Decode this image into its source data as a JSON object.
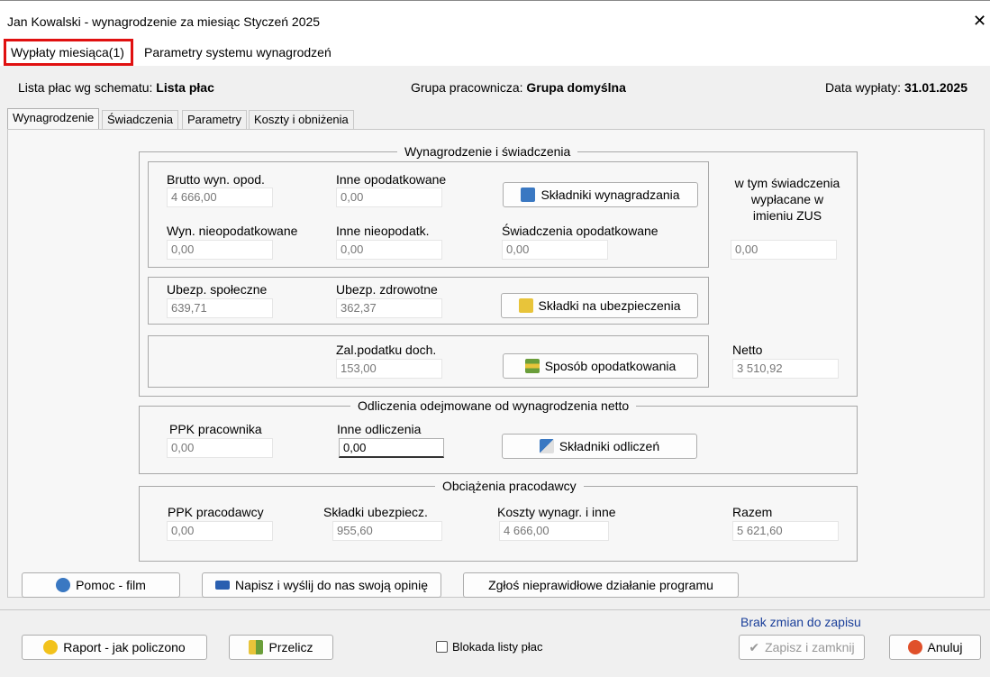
{
  "window": {
    "title": "Jan Kowalski - wynagrodzenie za miesiąc Styczeń 2025",
    "close": "✕"
  },
  "top_tabs": [
    "Wypłaty miesiąca(1)",
    "Parametry systemu wynagrodzeń"
  ],
  "header": {
    "schema_label": "Lista płac wg schematu:",
    "schema_value": "Lista płac",
    "group_label": "Grupa pracownicza:",
    "group_value": "Grupa domyślna",
    "date_label": "Data wypłaty:",
    "date_value": "31.01.2025"
  },
  "sub_tabs": [
    "Wynagrodzenie",
    "Świadczenia",
    "Parametry",
    "Koszty i obniżenia"
  ],
  "sec_wyn": {
    "title": "Wynagrodzenie i świadczenia",
    "brutto_label": "Brutto wyn. opod.",
    "brutto": "4 666,00",
    "inne_opod_label": "Inne opodatkowane",
    "inne_opod": "0,00",
    "wyn_nieopod_label": "Wyn. nieopodatkowane",
    "wyn_nieopod": "0,00",
    "inne_nieopod_label": "Inne nieopodatk.",
    "inne_nieopod": "0,00",
    "swiad_opod_label": "Świadczenia opodatkowane",
    "swiad_opod": "0,00",
    "zus_label": "w tym świadczenia wypłacane w imieniu ZUS",
    "zus": "0,00",
    "btn_skladniki": "Składniki wynagradzania",
    "ubezp_spol_label": "Ubezp. społeczne",
    "ubezp_spol": "639,71",
    "ubezp_zdr_label": "Ubezp. zdrowotne",
    "ubezp_zdr": "362,37",
    "btn_skladki": "Składki na ubezpieczenia",
    "zal_label": "Zal.podatku doch.",
    "zal": "153,00",
    "btn_sposob": "Sposób opodatkowania",
    "netto_label": "Netto",
    "netto": "3 510,92"
  },
  "sec_odl": {
    "title": "Odliczenia odejmowane od wynagrodzenia netto",
    "ppk_prac_label": "PPK pracownika",
    "ppk_prac": "0,00",
    "inne_odl_label": "Inne odliczenia",
    "inne_odl": "0,00",
    "btn_odl": "Składniki odliczeń"
  },
  "sec_obc": {
    "title": "Obciążenia pracodawcy",
    "ppk_pracod_label": "PPK pracodawcy",
    "ppk_pracod": "0,00",
    "skl_ubezp_label": "Składki ubezpiecz.",
    "skl_ubezp": "955,60",
    "koszty_label": "Koszty wynagr. i inne",
    "koszty": "4 666,00",
    "razem_label": "Razem",
    "razem": "5 621,60"
  },
  "help": {
    "film": "Pomoc - film",
    "opinia": "Napisz i wyślij do nas swoją opinię",
    "zglos": "Zgłoś nieprawidłowe działanie programu"
  },
  "footer": {
    "status": "Brak zmian do zapisu",
    "raport": "Raport - jak policzono",
    "przelicz": "Przelicz",
    "blokada": "Blokada listy płac",
    "zapisz": "Zapisz i zamknij",
    "anuluj": "Anuluj"
  }
}
